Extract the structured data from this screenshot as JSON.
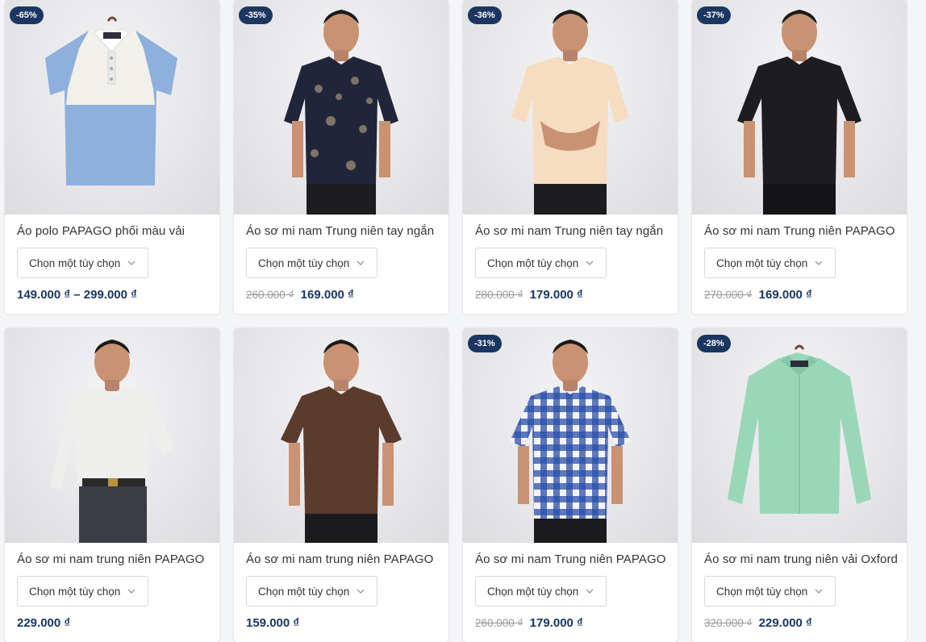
{
  "products": [
    {
      "badge": "-65%",
      "title": "Áo polo PAPAGO phối màu vải",
      "option": "Chọn một tùy chọn",
      "old_price": "",
      "price": "149.000 ₫ – 299.000 ₫",
      "image": "polo-shirt-on-hanger",
      "colors": {
        "main": "#8fb0dc",
        "accent": "#f1f0ea"
      }
    },
    {
      "badge": "-35%",
      "title": "Áo sơ mi nam Trung niên tay ngắn",
      "option": "Chọn một tùy chọn",
      "old_price": "260.000 ₫",
      "price": "169.000 ₫",
      "image": "man-wearing-navy-patterned-shirt",
      "colors": {
        "main": "#20253a",
        "accent": "#2a2a2a"
      }
    },
    {
      "badge": "-36%",
      "title": "Áo sơ mi nam Trung niên tay ngắn",
      "option": "Chọn một tùy chọn",
      "old_price": "280.000 ₫",
      "price": "179.000 ₫",
      "image": "man-wearing-cream-shirt",
      "colors": {
        "main": "#f6dcc0",
        "accent": "#2a2a2a"
      }
    },
    {
      "badge": "-37%",
      "title": "Áo sơ mi nam Trung niên PAPAGO",
      "option": "Chọn một tùy chọn",
      "old_price": "270.000 ₫",
      "price": "169.000 ₫",
      "image": "man-wearing-black-shirt",
      "colors": {
        "main": "#1d1d20",
        "accent": "#2a2a2a"
      }
    },
    {
      "badge": "",
      "title": "Áo sơ mi nam trung niên PAPAGO",
      "option": "Chọn một tùy chọn",
      "old_price": "",
      "price": "229.000 ₫",
      "image": "man-wearing-white-long-sleeve-shirt",
      "colors": {
        "main": "#eeeeec",
        "accent": "#3a3d44"
      }
    },
    {
      "badge": "",
      "title": "Áo sơ mi nam trung niên PAPAGO",
      "option": "Chọn một tùy chọn",
      "old_price": "",
      "price": "159.000 ₫",
      "image": "man-wearing-brown-shirt",
      "colors": {
        "main": "#5a3b2c",
        "accent": "#222222"
      }
    },
    {
      "badge": "-31%",
      "title": "Áo sơ mi nam Trung niên PAPAGO",
      "option": "Chọn một tùy chọn",
      "old_price": "260.000 ₫",
      "price": "179.000 ₫",
      "image": "man-wearing-blue-checked-shirt",
      "colors": {
        "main": "#2a4ea8",
        "accent": "#222222"
      }
    },
    {
      "badge": "-28%",
      "title": "Áo sơ mi nam trung niên vải Oxford",
      "option": "Chọn một tùy chọn",
      "old_price": "320.000 ₫",
      "price": "229.000 ₫",
      "image": "mint-shirt-on-hanger",
      "colors": {
        "main": "#9ad7b8",
        "accent": "#85c6a6"
      }
    }
  ]
}
